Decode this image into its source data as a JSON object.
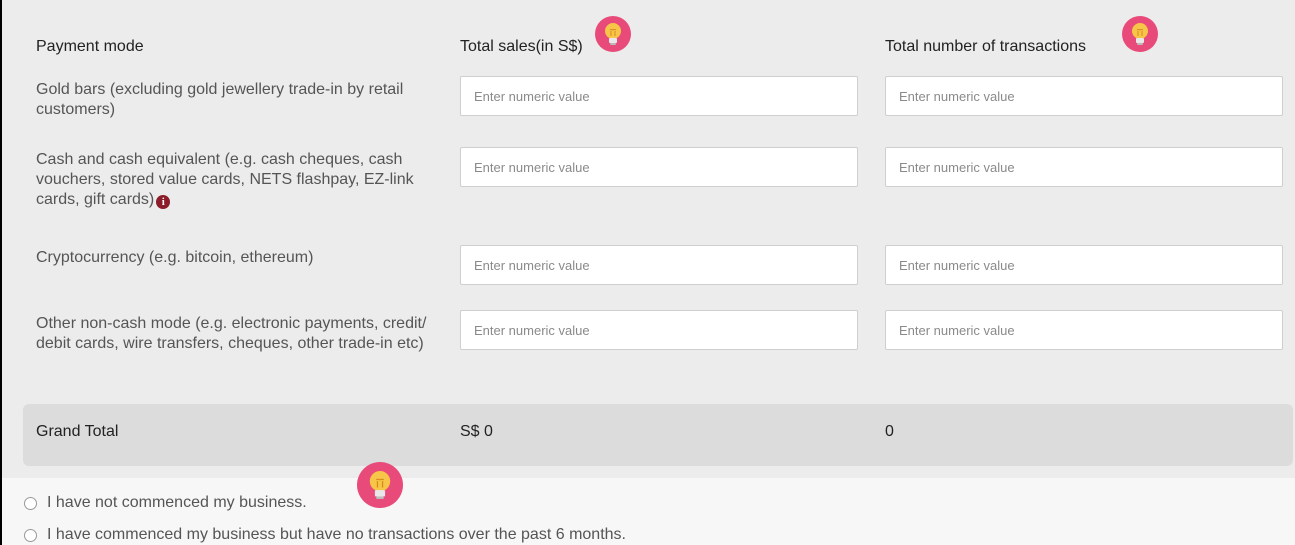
{
  "headers": {
    "payment_mode": "Payment mode",
    "total_sales": "Total sales(in S$)",
    "total_transactions": "Total number of transactions"
  },
  "rows": [
    {
      "label": "Gold bars (excluding gold jewellery trade-in by retail customers)",
      "sales_placeholder": "Enter numeric value",
      "tx_placeholder": "Enter numeric value"
    },
    {
      "label": "Cash and cash equivalent (e.g. cash cheques, cash vouchers, stored value cards, NETS flashpay, EZ-link cards, gift cards)",
      "sales_placeholder": "Enter numeric value",
      "tx_placeholder": "Enter numeric value"
    },
    {
      "label": "Cryptocurrency (e.g. bitcoin, ethereum)",
      "sales_placeholder": "Enter numeric value",
      "tx_placeholder": "Enter numeric value"
    },
    {
      "label": "Other non-cash mode (e.g. electronic payments, credit/ debit cards, wire transfers, cheques, other trade-in etc)",
      "sales_placeholder": "Enter numeric value",
      "tx_placeholder": "Enter numeric value"
    }
  ],
  "info_icon_glyph": "i",
  "grand_total": {
    "label": "Grand Total",
    "sales": "S$ 0",
    "transactions": "0"
  },
  "options": [
    "I have not commenced my business.",
    "I have commenced my business but have no transactions over the past 6 months."
  ],
  "colors": {
    "bulb_bg": "#e84a7a",
    "bulb_glow": "#f7c548",
    "info_icon": "#8c1d2a"
  }
}
